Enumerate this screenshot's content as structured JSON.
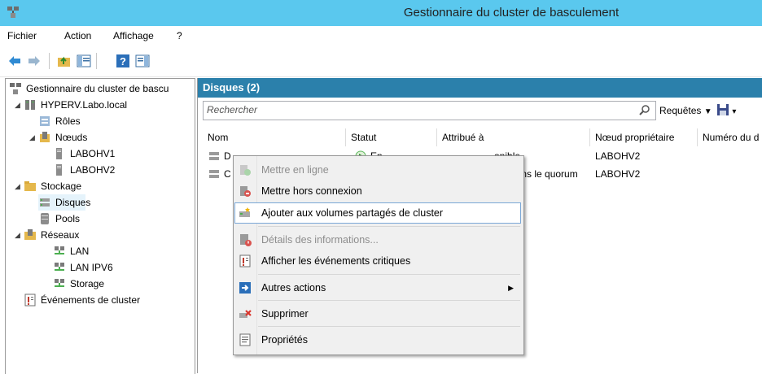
{
  "window": {
    "title": "Gestionnaire du cluster de basculement"
  },
  "menubar": {
    "items": [
      "Fichier",
      "Action",
      "Affichage",
      "?"
    ]
  },
  "tree": {
    "root": "Gestionnaire du cluster de bascu",
    "cluster": "HYPERV.Labo.local",
    "roles": "Rôles",
    "nodes": "Nœuds",
    "node1": "LABOHV1",
    "node2": "LABOHV2",
    "storage": "Stockage",
    "disks": "Disques",
    "pools": "Pools",
    "networks": "Réseaux",
    "net1": "LAN",
    "net2": "LAN IPV6",
    "net3": "Storage",
    "events": "Événements de cluster"
  },
  "panel": {
    "header": "Disques (2)",
    "search_placeholder": "Rechercher",
    "queries_label": "Requêtes",
    "columns": [
      "Nom",
      "Statut",
      "Attribué à",
      "Nœud propriétaire",
      "Numéro du d"
    ],
    "rows": [
      {
        "name": "D",
        "status": "En",
        "assigned": "onible",
        "owner": "LABOHV2"
      },
      {
        "name": "C",
        "status": "",
        "assigned": "dans le quorum",
        "owner": "LABOHV2"
      }
    ]
  },
  "context_menu": {
    "items": [
      {
        "label": "Mettre en ligne",
        "icon": "bring-online-icon",
        "disabled": true
      },
      {
        "label": "Mettre hors connexion",
        "icon": "take-offline-icon",
        "disabled": false
      },
      {
        "label": "Ajouter aux volumes partagés de cluster",
        "icon": "add-csv-icon",
        "disabled": false,
        "highlighted": true
      },
      {
        "label": "Détails des informations...",
        "icon": "info-details-icon",
        "disabled": true
      },
      {
        "label": "Afficher les événements critiques",
        "icon": "critical-events-icon",
        "disabled": false
      },
      {
        "label": "Autres actions",
        "icon": "more-actions-icon",
        "disabled": false,
        "submenu": true
      },
      {
        "label": "Supprimer",
        "icon": "delete-icon",
        "disabled": false
      },
      {
        "label": "Propriétés",
        "icon": "properties-icon",
        "disabled": false
      }
    ]
  },
  "colors": {
    "titlebar": "#5ac8ee",
    "panel_header": "#2b80ab"
  }
}
